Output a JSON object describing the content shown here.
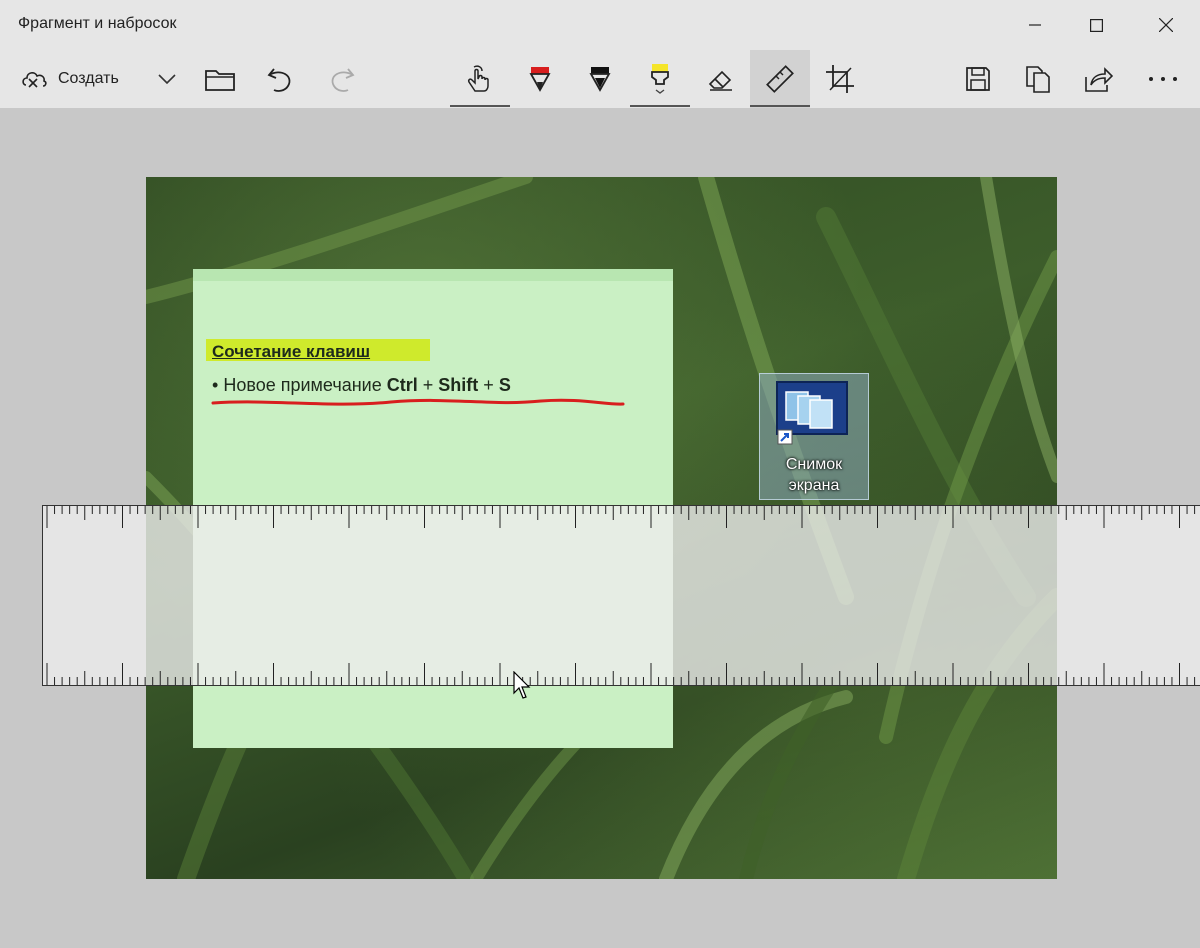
{
  "window": {
    "title": "Фрагмент и набросок"
  },
  "toolbar": {
    "create_label": "Создать",
    "left_tools": [
      "new-snip-icon",
      "chevron-down-icon",
      "folder-icon",
      "undo-icon",
      "redo-icon"
    ],
    "draw_tools": [
      "touch-writing-icon",
      "ballpoint-pen-icon",
      "pencil-icon",
      "highlighter-icon",
      "eraser-icon",
      "ruler-icon",
      "crop-icon"
    ],
    "right_tools": [
      "save-icon",
      "copy-icon",
      "share-icon",
      "more-icon"
    ],
    "active_tool": "ruler",
    "colors": {
      "ballpoint": "#d81e1e",
      "pencil": "#111111",
      "highlighter": "#f5e52a"
    }
  },
  "note": {
    "heading": "Сочетание клавиш",
    "bullet_text": "Новое примечание",
    "key1": "Ctrl",
    "plus1": "+",
    "key2": "Shift",
    "plus2": "+",
    "key3": "S",
    "highlight_color": "#cfea2c",
    "underline_color": "#d81e1e"
  },
  "desktop_icon": {
    "label_line1": "Снимок",
    "label_line2": "экрана"
  }
}
